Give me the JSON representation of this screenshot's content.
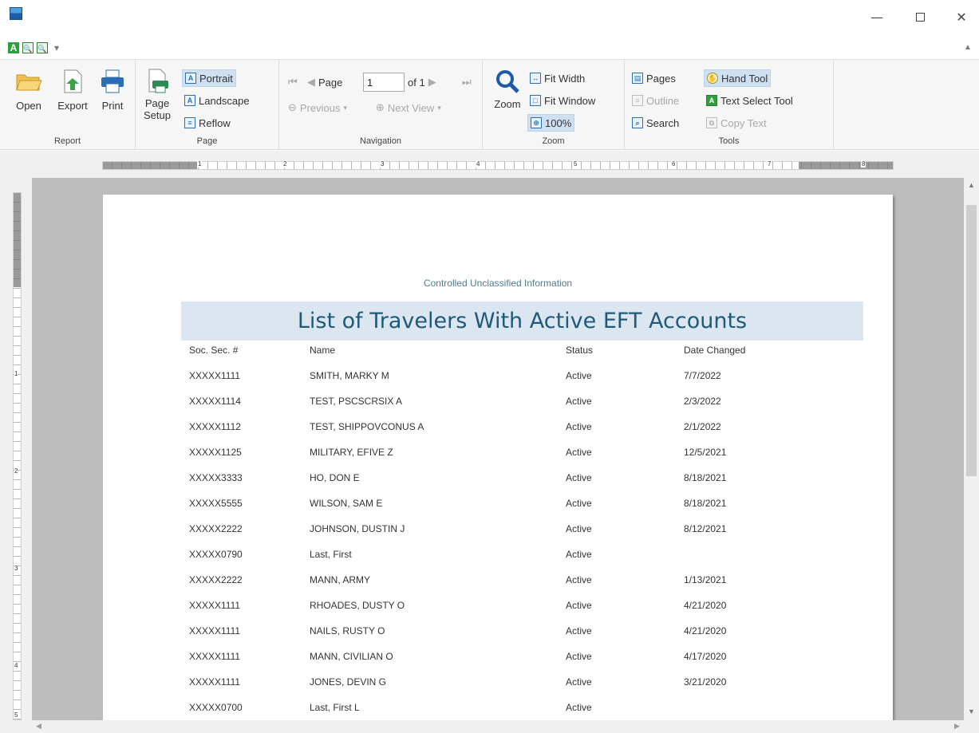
{
  "window": {
    "minimize": "—",
    "close": "✕"
  },
  "ribbon": {
    "groups": {
      "report": "Report",
      "page": "Page",
      "navigation": "Navigation",
      "zoom": "Zoom",
      "tools": "Tools"
    },
    "report": {
      "open": "Open",
      "export": "Export",
      "print": "Print"
    },
    "page": {
      "setup_line1": "Page",
      "setup_line2": "Setup",
      "portrait": "Portrait",
      "landscape": "Landscape",
      "reflow": "Reflow"
    },
    "navigation": {
      "page_label": "Page",
      "page_value": "1",
      "of_label": "of 1",
      "previous_view": "Previous",
      "next_view": "Next View"
    },
    "zoom": {
      "zoom": "Zoom",
      "fit_width": "Fit Width",
      "fit_window": "Fit Window",
      "hundred": "100%"
    },
    "tools": {
      "pages": "Pages",
      "outline": "Outline",
      "search": "Search",
      "hand_tool": "Hand Tool",
      "text_select_tool": "Text Select Tool",
      "copy_text": "Copy Text"
    }
  },
  "ruler": {
    "h_numbers": [
      "1",
      "2",
      "3",
      "4",
      "5",
      "6",
      "7",
      "8"
    ],
    "v_numbers": [
      "1",
      "2",
      "3",
      "4",
      "5"
    ]
  },
  "report": {
    "cui": "Controlled Unclassified Information",
    "title": "List of Travelers With Active EFT Accounts",
    "headers": [
      "Soc. Sec. #",
      "Name",
      "Status",
      "Date Changed"
    ],
    "rows": [
      [
        "XXXXX1111",
        "SMITH, MARKY M",
        "Active",
        "7/7/2022"
      ],
      [
        "XXXXX1114",
        "TEST, PSCSCRSIX A",
        "Active",
        "2/3/2022"
      ],
      [
        "XXXXX1112",
        "TEST, SHIPPOVCONUS A",
        "Active",
        "2/1/2022"
      ],
      [
        "XXXXX1125",
        "MILITARY, EFIVE Z",
        "Active",
        "12/5/2021"
      ],
      [
        "XXXXX3333",
        "HO, DON E",
        "Active",
        "8/18/2021"
      ],
      [
        "XXXXX5555",
        "WILSON, SAM E",
        "Active",
        "8/18/2021"
      ],
      [
        "XXXXX2222",
        "JOHNSON, DUSTIN J",
        "Active",
        "8/12/2021"
      ],
      [
        "XXXXX0790",
        "Last, First",
        "Active",
        ""
      ],
      [
        "XXXXX2222",
        "MANN, ARMY",
        "Active",
        "1/13/2021"
      ],
      [
        "XXXXX1111",
        "RHOADES, DUSTY O",
        "Active",
        "4/21/2020"
      ],
      [
        "XXXXX1111",
        "NAILS, RUSTY O",
        "Active",
        "4/21/2020"
      ],
      [
        "XXXXX1111",
        "MANN, CIVILIAN O",
        "Active",
        "4/17/2020"
      ],
      [
        "XXXXX1111",
        "JONES, DEVIN G",
        "Active",
        "3/21/2020"
      ],
      [
        "XXXXX0700",
        "Last, First L",
        "Active",
        ""
      ]
    ]
  }
}
